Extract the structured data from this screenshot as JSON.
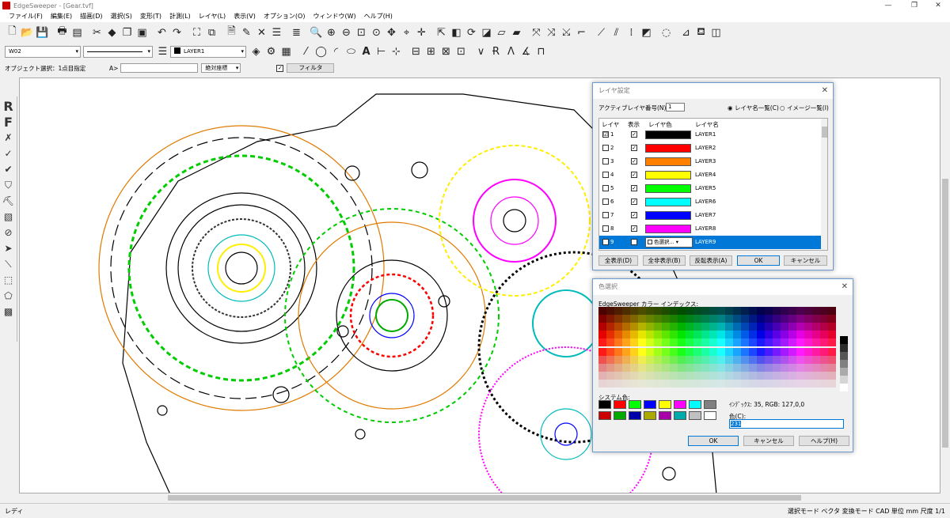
{
  "window": {
    "title": "EdgeSweeper - [Gear.tvf]",
    "controls": [
      "—",
      "❐",
      "✕"
    ]
  },
  "menu": [
    "ファイル(F)",
    "編集(E)",
    "描画(D)",
    "選択(S)",
    "変形(T)",
    "計測(L)",
    "レイヤ(L)",
    "表示(V)",
    "オプション(O)",
    "ウィンドウ(W)",
    "ヘルプ(H)"
  ],
  "toolbar2": {
    "pen_value": "W02",
    "layer_value": "LAYER1"
  },
  "optrow": {
    "mode_label": "オブジェクト選択：1点目指定",
    "coord_prefix": "A>",
    "coord_mode": "絶対座標",
    "filter_label": "フィルタ"
  },
  "left_tools": {
    "r_label": "R",
    "f_label": "F"
  },
  "layer_dialog": {
    "title": "レイヤ設定",
    "active_label": "アクティブレイヤ番号(N):",
    "active_value": "1",
    "radio1": "レイヤ名一覧(C)",
    "radio2": "イメージ一覧(I)",
    "columns": [
      "レイヤ",
      "表示",
      "レイヤ色",
      "レイヤ名"
    ],
    "rows": [
      {
        "num": "1",
        "name": "LAYER1",
        "color": "#000000",
        "check": "☑"
      },
      {
        "num": "2",
        "name": "LAYER2",
        "color": "#ff0000",
        "check": ""
      },
      {
        "num": "3",
        "name": "LAYER3",
        "color": "#ff7f00",
        "check": ""
      },
      {
        "num": "4",
        "name": "LAYER4",
        "color": "#ffff00",
        "check": ""
      },
      {
        "num": "5",
        "name": "LAYER5",
        "color": "#00ff00",
        "check": ""
      },
      {
        "num": "6",
        "name": "LAYER6",
        "color": "#00ffff",
        "check": ""
      },
      {
        "num": "7",
        "name": "LAYER7",
        "color": "#0000ff",
        "check": ""
      },
      {
        "num": "8",
        "name": "LAYER8",
        "color": "#ff00ff",
        "check": ""
      },
      {
        "num": "9",
        "name": "LAYER9",
        "color": "",
        "check": ""
      }
    ],
    "color_picker_label": "色選択...",
    "buttons": {
      "show_all": "全表示(D)",
      "hide_all": "全非表示(B)",
      "invert": "反転表示(A)",
      "ok": "OK",
      "cancel": "キャンセル"
    }
  },
  "color_dialog": {
    "title": "色選択",
    "palette_label": "EdgeSweeper カラー インデックス:",
    "system_label": "システム色:",
    "info": "ｲﾝﾃﾞｯｸｽ: 35, RGB: 127,0,0",
    "color_label": "色(C):",
    "color_value": "231",
    "buttons": {
      "ok": "OK",
      "cancel": "キャンセル",
      "help": "ヘルプ(H)"
    },
    "system_colors": [
      "#000000",
      "#ff0000",
      "#00ff00",
      "#0000ff",
      "#ffff00",
      "#ff00ff",
      "#00ffff",
      "#808080",
      "#cc0000",
      "#00aa00",
      "#0000aa",
      "#aaaa00",
      "#aa00aa",
      "#00aaaa",
      "#c0c0c0",
      "#ffffff"
    ]
  },
  "statusbar": {
    "ready": "レディ",
    "right": "選択モード ベクタ  変換モード CAD  単位 mm  尺度 1/1"
  }
}
